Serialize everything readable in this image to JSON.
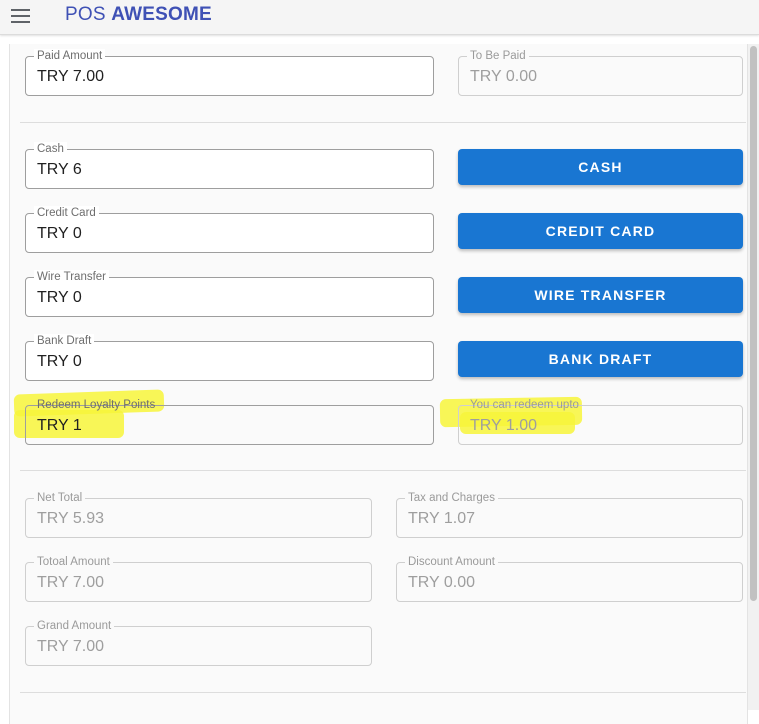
{
  "app": {
    "title_prefix": "POS",
    "title_name": "AWESOME"
  },
  "payment": {
    "paid_amount": {
      "label": "Paid Amount",
      "value": "TRY 7.00"
    },
    "to_be_paid": {
      "label": "To Be Paid",
      "value": "TRY 0.00"
    }
  },
  "methods": [
    {
      "label": "Cash",
      "value": "TRY 6",
      "button": "CASH"
    },
    {
      "label": "Credit Card",
      "value": "TRY 0",
      "button": "CREDIT CARD"
    },
    {
      "label": "Wire Transfer",
      "value": "TRY 0",
      "button": "WIRE TRANSFER"
    },
    {
      "label": "Bank Draft",
      "value": "TRY 0",
      "button": "BANK DRAFT"
    }
  ],
  "loyalty": {
    "redeem": {
      "label": "Redeem Loyalty Points",
      "value": "TRY 1"
    },
    "max": {
      "label": "You can redeem upto",
      "value": "TRY 1.00"
    }
  },
  "totals": {
    "net_total": {
      "label": "Net Total",
      "value": "TRY 5.93"
    },
    "tax": {
      "label": "Tax and Charges",
      "value": "TRY 1.07"
    },
    "total_amount": {
      "label": "Totoal Amount",
      "value": "TRY 7.00"
    },
    "discount": {
      "label": "Discount Amount",
      "value": "TRY 0.00"
    },
    "grand_amount": {
      "label": "Grand Amount",
      "value": "TRY 7.00"
    }
  },
  "colors": {
    "primary": "#1976d2",
    "title": "#3f51b5",
    "highlight": "#f7f53a"
  },
  "icons": {
    "menu": "hamburger-menu-icon"
  }
}
